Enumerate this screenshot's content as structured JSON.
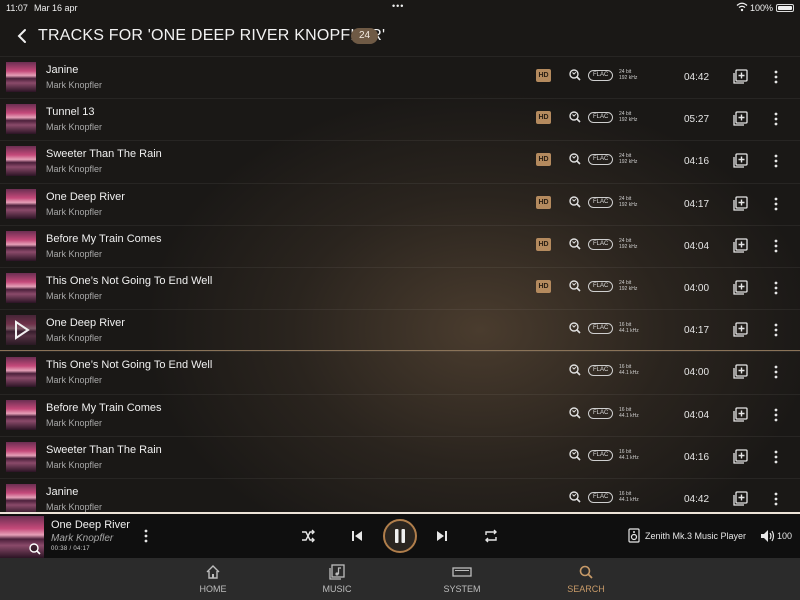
{
  "status_bar": {
    "time": "11:07",
    "date": "Mar 16 apr",
    "battery": "100%"
  },
  "header": {
    "title": "TRACKS FOR 'ONE DEEP RIVER KNOPFLER'",
    "count": "24"
  },
  "tracks": [
    {
      "title": "Janine",
      "artist": "Mark Knopfler",
      "hd": "HD",
      "format": "FLAC",
      "bits": "24 bit",
      "rate": "192 kHz",
      "duration": "04:42"
    },
    {
      "title": "Tunnel 13",
      "artist": "Mark Knopfler",
      "hd": "HD",
      "format": "FLAC",
      "bits": "24 bit",
      "rate": "192 kHz",
      "duration": "05:27"
    },
    {
      "title": "Sweeter Than The Rain",
      "artist": "Mark Knopfler",
      "hd": "HD",
      "format": "FLAC",
      "bits": "24 bit",
      "rate": "192 kHz",
      "duration": "04:16"
    },
    {
      "title": "One Deep River",
      "artist": "Mark Knopfler",
      "hd": "HD",
      "format": "FLAC",
      "bits": "24 bit",
      "rate": "192 kHz",
      "duration": "04:17"
    },
    {
      "title": "Before My Train Comes",
      "artist": "Mark Knopfler",
      "hd": "HD",
      "format": "FLAC",
      "bits": "24 bit",
      "rate": "192 kHz",
      "duration": "04:04"
    },
    {
      "title": "This One’s Not Going To End Well",
      "artist": "Mark Knopfler",
      "hd": "HD",
      "format": "FLAC",
      "bits": "24 bit",
      "rate": "192 kHz",
      "duration": "04:00"
    },
    {
      "title": "One Deep River",
      "artist": "Mark Knopfler",
      "hd": "",
      "format": "FLAC",
      "bits": "16 bit",
      "rate": "44.1 kHz",
      "duration": "04:17",
      "playing": true
    },
    {
      "title": "This One’s Not Going To End Well",
      "artist": "Mark Knopfler",
      "hd": "",
      "format": "FLAC",
      "bits": "16 bit",
      "rate": "44.1 kHz",
      "duration": "04:00"
    },
    {
      "title": "Before My Train Comes",
      "artist": "Mark Knopfler",
      "hd": "",
      "format": "FLAC",
      "bits": "16 bit",
      "rate": "44.1 kHz",
      "duration": "04:04"
    },
    {
      "title": "Sweeter Than The Rain",
      "artist": "Mark Knopfler",
      "hd": "",
      "format": "FLAC",
      "bits": "16 bit",
      "rate": "44.1 kHz",
      "duration": "04:16"
    },
    {
      "title": "Janine",
      "artist": "Mark Knopfler",
      "hd": "",
      "format": "FLAC",
      "bits": "16 bit",
      "rate": "44.1 kHz",
      "duration": "04:42"
    }
  ],
  "now_playing": {
    "title": "One Deep River",
    "artist": "Mark Knopfler",
    "time": "00:38 / 04:17",
    "device": "Zenith Mk.3 Music Player",
    "volume": "100"
  },
  "tabs": [
    {
      "label": "HOME",
      "icon": "home-icon"
    },
    {
      "label": "MUSIC",
      "icon": "music-icon"
    },
    {
      "label": "SYSTEM",
      "icon": "system-icon"
    },
    {
      "label": "SEARCH",
      "icon": "search-icon",
      "active": true
    }
  ],
  "colors": {
    "accent": "#c79a68",
    "hd_badge": "#b48a5e",
    "count_badge": "#6f5a45"
  }
}
